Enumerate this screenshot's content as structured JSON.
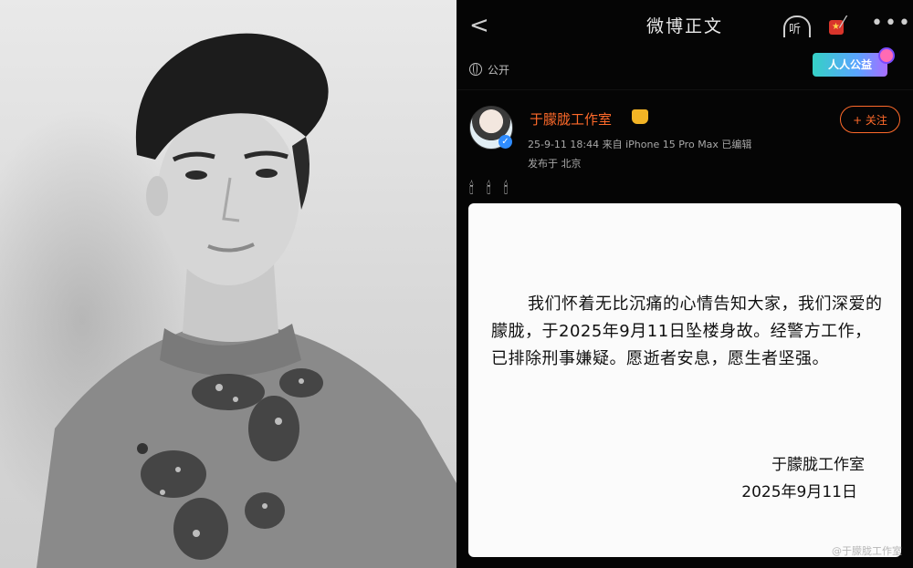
{
  "photo": {
    "alt": ""
  },
  "topbar": {
    "back_icon": "<",
    "title": "微博正文",
    "listen_label": "听",
    "more_icon": "•••"
  },
  "post": {
    "visibility": "公开",
    "charity_badge": "人人公益",
    "user": {
      "name": "于朦胧工作室"
    },
    "meta_line1": "25-9-11 18:44 来自 iPhone 15 Pro Max 已编辑",
    "meta_line2": "发布于 北京",
    "follow_label": "+ 关注",
    "candles": [
      "🕯",
      "🕯",
      "🕯"
    ],
    "card": {
      "body": "我们怀着无比沉痛的心情告知大家，我们深爱的朦胧，于2025年9月11日坠楼身故。经警方工作，已排除刑事嫌疑。愿逝者安息，愿生者坚强。",
      "signature": "于朦胧工作室",
      "date": "2025年9月11日"
    },
    "watermark": "@于朦胧工作室"
  },
  "colors": {
    "accent": "#ff6a2a",
    "verified": "#2f8cff"
  }
}
